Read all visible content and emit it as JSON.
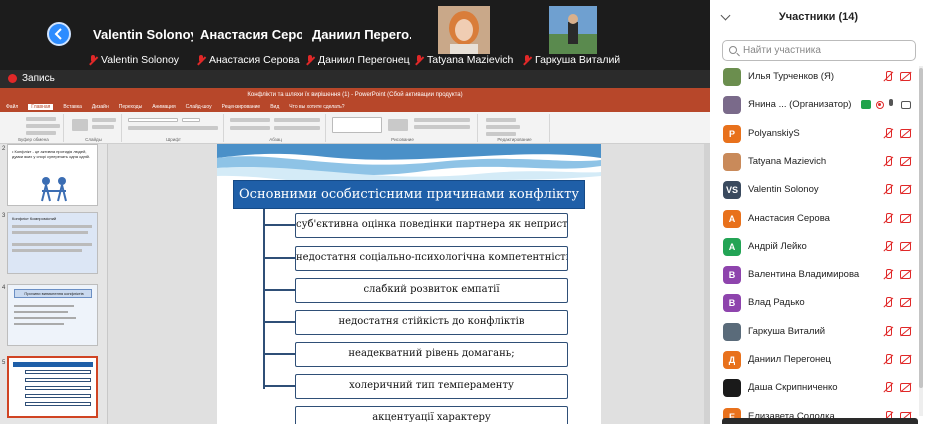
{
  "video_strip": {
    "tiles": [
      {
        "big": "Valentin Solonoy",
        "small": "Valentin Solonoy"
      },
      {
        "big": "Анастасия  Серо...",
        "small": "Анастасия Серова"
      },
      {
        "big": "Даниил  Перего...",
        "small": "Даниил Перегонец"
      },
      {
        "big": "",
        "small": "Tatyana Mazievich"
      },
      {
        "big": "",
        "small": "Гаркуша Виталий"
      }
    ]
  },
  "recording": {
    "label": "Запись"
  },
  "powerpoint": {
    "window_title": "Конфлікти та шляхи їх вирішення (1) - PowerPoint (Сбой активации продукта)",
    "tabs": [
      "Файл",
      "Главная",
      "Вставка",
      "Дизайн",
      "Переходы",
      "Анимация",
      "Слайд-шоу",
      "Рецензирование",
      "Вид",
      "Что вы хотите сделать?"
    ],
    "active_tab": "Главная",
    "groups": [
      "Буфер обмена",
      "Слайды",
      "Шрифт",
      "Абзац",
      "Рисование",
      "Редактирование"
    ],
    "thumbnails": [
      {
        "num": "2",
        "text": "• Конфлікт - це активна протидія людей, думки яких у спорі суперечать одна одній."
      },
      {
        "num": "3",
        "text": "Конфлікт   Компромісний"
      },
      {
        "num": "4",
        "text": "Причини виникнення конфліктів"
      },
      {
        "num": "5",
        "text": ""
      }
    ],
    "slide": {
      "heading": "Основними особистісними причинами конфлікту є:",
      "causes": [
        "суб'єктивна оцінка поведінки партнера як непристойної;",
        "недостатня соціально-психологічна компетентність;",
        "слабкий розвиток емпатії",
        "недостатня стійкість до конфліктів",
        "неадекватний рівень домагань;",
        "холеричний тип темпераменту",
        "акцентуації характеру"
      ]
    }
  },
  "participants": {
    "title": "Участники (14)",
    "search_placeholder": "Найти участника",
    "list": [
      {
        "initials": "",
        "color": "#6b8e4e",
        "name": "Илья Турченков (Я)"
      },
      {
        "initials": "",
        "color": "#7a6a8a",
        "name": "Янина ...   (Организатор)"
      },
      {
        "initials": "P",
        "color": "#e8711c",
        "name": "PolyanskiyS"
      },
      {
        "initials": "",
        "color": "#c98a5a",
        "name": "Tatyana Mazievich"
      },
      {
        "initials": "VS",
        "color": "#3a4a5e",
        "name": "Valentin Solonoy"
      },
      {
        "initials": "А",
        "color": "#e8711c",
        "name": "Анастасия Серова"
      },
      {
        "initials": "А",
        "color": "#23a455",
        "name": "Андрій Лейко"
      },
      {
        "initials": "В",
        "color": "#8e44ad",
        "name": "Валентина Владимирова"
      },
      {
        "initials": "В",
        "color": "#8e44ad",
        "name": "Влад Радько"
      },
      {
        "initials": "",
        "color": "#5a6b7a",
        "name": "Гаркуша Виталий"
      },
      {
        "initials": "Д",
        "color": "#e8711c",
        "name": "Даниил Перегонец"
      },
      {
        "initials": "",
        "color": "#1a1a1a",
        "name": "Даша Скрипниченко"
      },
      {
        "initials": "Е",
        "color": "#e8711c",
        "name": "Елизавета Солодка"
      }
    ]
  }
}
